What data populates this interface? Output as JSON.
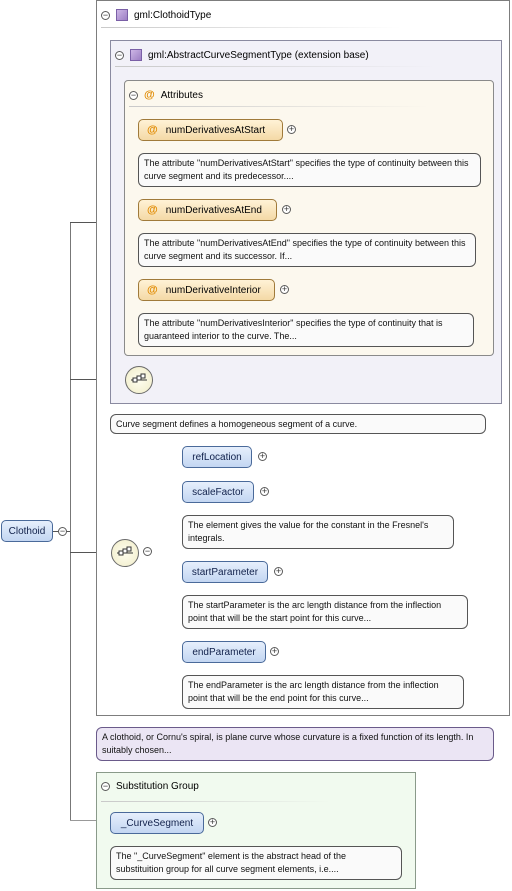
{
  "clothoid_type": {
    "label": "gml:ClothoidType"
  },
  "base_type": {
    "label": "gml:AbstractCurveSegmentType (extension base)"
  },
  "attributes": {
    "label": "Attributes",
    "items": [
      {
        "name": "numDerivativesAtStart",
        "doc": "The attribute \"numDerivativesAtStart\" specifies the type of continuity between this curve segment and its predecessor...."
      },
      {
        "name": "numDerivativesAtEnd",
        "doc": "The attribute \"numDerivativesAtEnd\" specifies the type of continuity between this curve segment and its successor. If..."
      },
      {
        "name": "numDerivativeInterior",
        "doc": "The attribute \"numDerivativesInterior\" specifies the type of continuity that is guaranteed interior to the curve. The..."
      }
    ]
  },
  "base_doc": "Curve segment defines a homogeneous segment of a curve.",
  "sequence_elements": [
    {
      "name": "refLocation",
      "doc": ""
    },
    {
      "name": "scaleFactor",
      "doc": "The element gives the value for the constant in the Fresnel's integrals."
    },
    {
      "name": "startParameter",
      "doc": "The startParameter is the arc length distance from the inflection point that will be the start point for this curve..."
    },
    {
      "name": "endParameter",
      "doc": "The endParameter is the arc length distance from the inflection point that will be the end point for this curve..."
    }
  ],
  "root_element": {
    "name": "Clothoid"
  },
  "clothoid_doc": "A clothoid, or Cornu's spiral, is plane curve whose curvature is a fixed function of its length. In suitably chosen...",
  "substitution_group": {
    "label": "Substitution Group",
    "element": "_CurveSegment",
    "doc": "The \"_CurveSegment\" element is the abstract head of the substituition group for all curve segment elements, i.e...."
  },
  "icons": {
    "collapse": "minus-circle-icon",
    "expand": "plus-circle-icon",
    "sequence": "sequence-icon",
    "type": "complex-type-icon",
    "attribute": "attribute-at-icon"
  }
}
